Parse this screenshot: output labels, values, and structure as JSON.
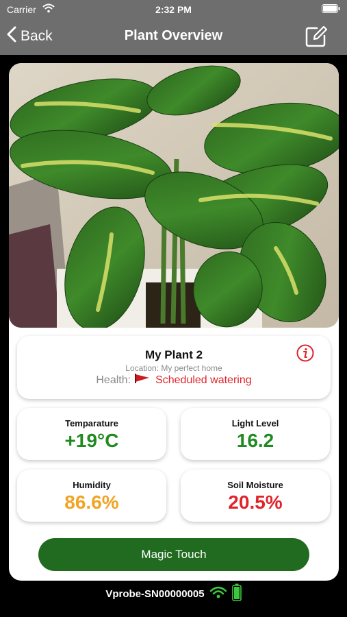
{
  "status_bar": {
    "carrier": "Carrier",
    "time": "2:32 PM",
    "icons": [
      "wifi-icon",
      "battery-icon"
    ]
  },
  "nav": {
    "back_label": "Back",
    "title": "Plant Overview",
    "edit_icon": "edit-icon"
  },
  "plant": {
    "photo": "houseplant-photo",
    "name": "My Plant 2",
    "location": "Location: My perfect home",
    "health_label": "Health:",
    "health_status": "Scheduled watering",
    "health_icon": "red-flag-icon",
    "info_icon": "info-icon"
  },
  "metrics": [
    {
      "label": "Temparature",
      "value": "+19°C",
      "color": "#1f8a1f"
    },
    {
      "label": "Light Level",
      "value": "16.2",
      "color": "#1f8a1f"
    },
    {
      "label": "Humidity",
      "value": "86.6%",
      "color": "#f2a322"
    },
    {
      "label": "Soil Moisture",
      "value": "20.5%",
      "color": "#e0242b"
    }
  ],
  "action": {
    "label": "Magic Touch"
  },
  "footer": {
    "device": "Vprobe-SN00000005",
    "icons": [
      "wifi-signal-icon",
      "battery-full-icon"
    ]
  },
  "colors": {
    "header_bg": "#6e6e6e",
    "accent_green": "#216b21",
    "health_red": "#e0242b"
  }
}
